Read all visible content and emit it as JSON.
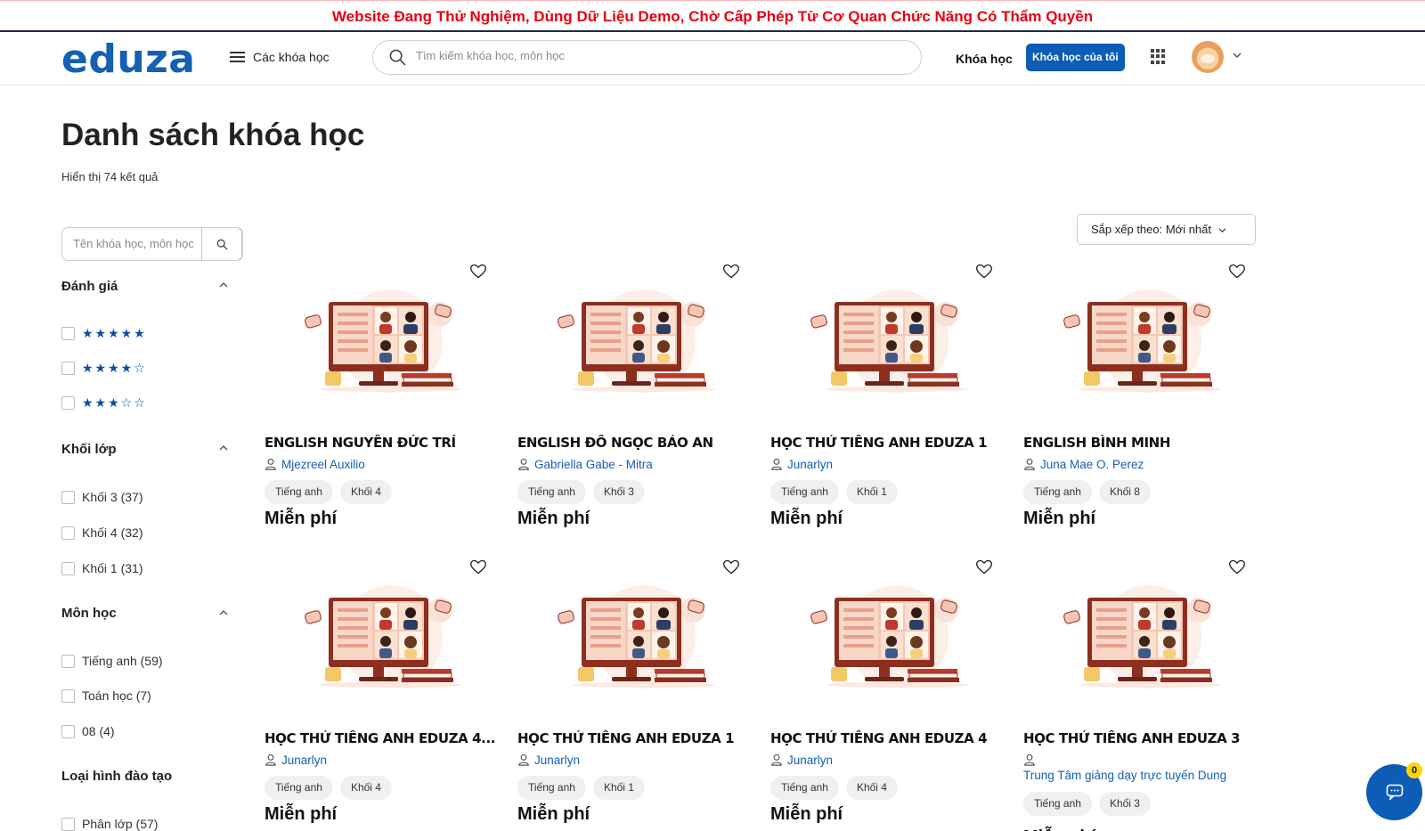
{
  "banner": {
    "text": "Website Đang Thử Nghiệm, Dùng Dữ Liệu Demo, Chờ Cấp Phép Từ Cơ Quan Chức Năng Có Thẩm Quyền"
  },
  "header": {
    "logo": "eduza",
    "menu_label": "Các khóa học",
    "search_placeholder": "Tìm kiếm khóa học, môn học",
    "nav_course": "Khóa học",
    "my_course_button": "Khóa học của tôi"
  },
  "page": {
    "title": "Danh sách khóa học",
    "result_count": "Hiển thị 74 kết quả",
    "sort_label": "Sắp xếp theo: Mới nhất"
  },
  "sidebar": {
    "search_placeholder": "Tên khóa học, môn học",
    "rating": {
      "title": "Đánh giá",
      "options": [
        "★★★★★",
        "★★★★☆",
        "★★★☆☆"
      ]
    },
    "grade": {
      "title": "Khối lớp",
      "options": [
        "Khối 3 (37)",
        "Khối 4 (32)",
        "Khối 1 (31)"
      ]
    },
    "subject": {
      "title": "Môn học",
      "options": [
        "Tiếng anh (59)",
        "Toán học (7)",
        "08 (4)"
      ]
    },
    "training": {
      "title": "Loại hình đào tạo",
      "options": [
        "Phân lớp (57)"
      ]
    }
  },
  "courses": [
    {
      "title": "ENGLISH NGUYỄN ĐỨC TRÍ",
      "author": "Mjezreel Auxilio",
      "subject": "Tiếng anh",
      "grade": "Khối 4",
      "price": "Miễn phí"
    },
    {
      "title": "ENGLISH ĐỖ NGỌC BẢO AN",
      "author": "Gabriella Gabe - Mitra",
      "subject": "Tiếng anh",
      "grade": "Khối 3",
      "price": "Miễn phí"
    },
    {
      "title": "HỌC THỬ TIẾNG ANH EDUZA 1",
      "author": "Junarlyn",
      "subject": "Tiếng anh",
      "grade": "Khối 1",
      "price": "Miễn phí"
    },
    {
      "title": "ENGLISH BÌNH MINH",
      "author": "Juna Mae O. Perez",
      "subject": "Tiếng anh",
      "grade": "Khối 8",
      "price": "Miễn phí"
    },
    {
      "title": "HỌC THỬ TIẾNG ANH EDUZA 4...",
      "author": "Junarlyn",
      "subject": "Tiếng anh",
      "grade": "Khối 4",
      "price": "Miễn phí"
    },
    {
      "title": "HỌC THỬ TIẾNG ANH EDUZA 1",
      "author": "Junarlyn",
      "subject": "Tiếng anh",
      "grade": "Khối 1",
      "price": "Miễn phí"
    },
    {
      "title": "HỌC THỬ TIẾNG ANH EDUZA 4",
      "author": "Junarlyn",
      "subject": "Tiếng anh",
      "grade": "Khối 4",
      "price": "Miễn phí"
    },
    {
      "title": "HỌC THỬ TIẾNG ANH EDUZA 3",
      "author": "Trung Tâm giảng dạy trực tuyến Dung",
      "subject": "Tiếng anh",
      "grade": "Khối 3",
      "price": "Miễn phí"
    }
  ],
  "chat": {
    "badge": "0"
  },
  "colors": {
    "brand": "#1460b3",
    "banner_text": "#e60012",
    "button": "#0d5cb6",
    "badge": "#ffd600"
  },
  "icons": [
    "hamburger-icon",
    "search-icon",
    "apps-grid-icon",
    "chevron-down-icon",
    "heart-icon",
    "user-icon",
    "chat-icon"
  ]
}
